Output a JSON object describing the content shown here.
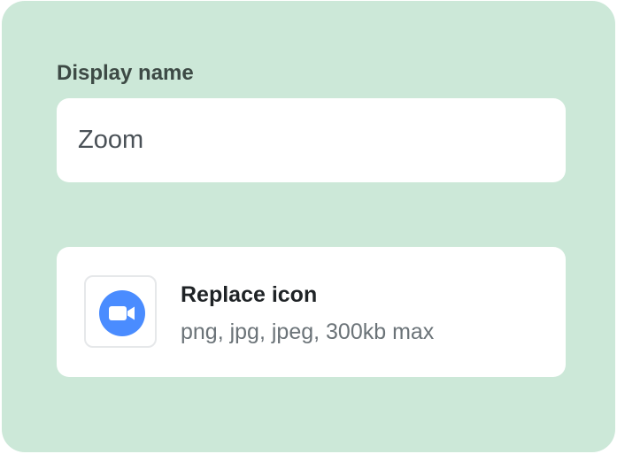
{
  "display_name": {
    "label": "Display name",
    "value": "Zoom"
  },
  "icon_upload": {
    "title": "Replace icon",
    "hint": "png, jpg, jpeg, 300kb max",
    "current_icon": "zoom-camera-icon"
  },
  "colors": {
    "panel_background": "#cce8d8",
    "zoom_blue": "#4a8cff"
  }
}
